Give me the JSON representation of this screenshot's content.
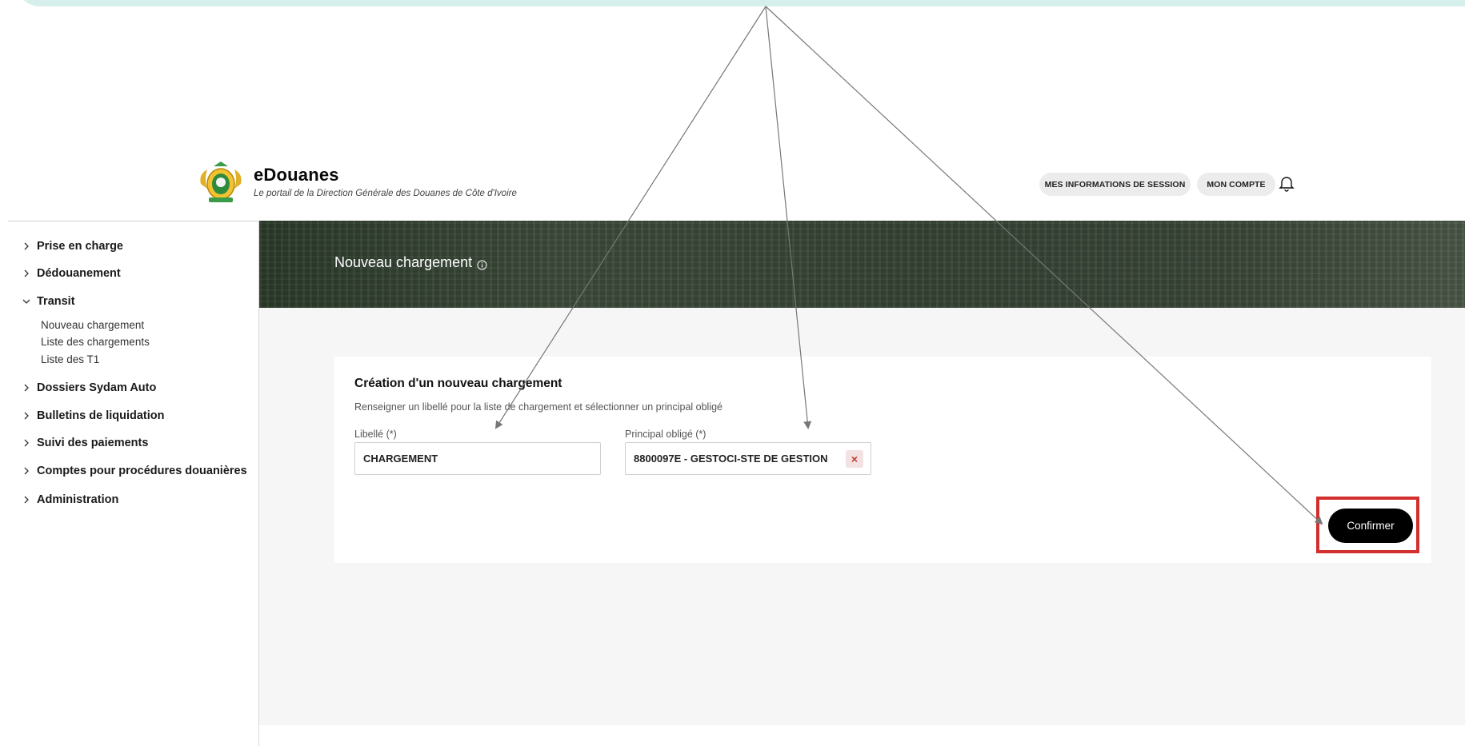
{
  "brand": {
    "title": "eDouanes",
    "subtitle": "Le portail de la Direction Générale des Douanes de Côte d'Ivoire"
  },
  "header": {
    "session_label": "MES INFORMATIONS DE SESSION",
    "account_label": "MON COMPTE"
  },
  "sidebar": {
    "items": [
      {
        "label": "Prise en charge",
        "expanded": false
      },
      {
        "label": "Dédouanement",
        "expanded": false
      },
      {
        "label": "Transit",
        "expanded": true
      },
      {
        "label": "Dossiers Sydam Auto",
        "expanded": false
      },
      {
        "label": "Bulletins de liquidation",
        "expanded": false
      },
      {
        "label": "Suivi des paiements",
        "expanded": false
      },
      {
        "label": "Comptes pour procédures douanières",
        "expanded": false
      },
      {
        "label": "Administration",
        "expanded": false
      }
    ],
    "transit_sub": [
      "Nouveau chargement",
      "Liste des chargements",
      "Liste des T1"
    ]
  },
  "page": {
    "title": "Nouveau chargement"
  },
  "form": {
    "title": "Création d'un nouveau chargement",
    "description": "Renseigner un libellé pour la liste de chargement et sélectionner un principal obligé",
    "libelle_label": "Libellé (*)",
    "libelle_value": "CHARGEMENT",
    "principal_label": "Principal obligé (*)",
    "principal_value": "8800097E - GESTOCI-STE DE GESTION",
    "clear_symbol": "×",
    "confirm_label": "Confirmer"
  },
  "colors": {
    "highlight": "#d32f2f",
    "confirm_bg": "#000000",
    "top_band": "#d6efec"
  }
}
